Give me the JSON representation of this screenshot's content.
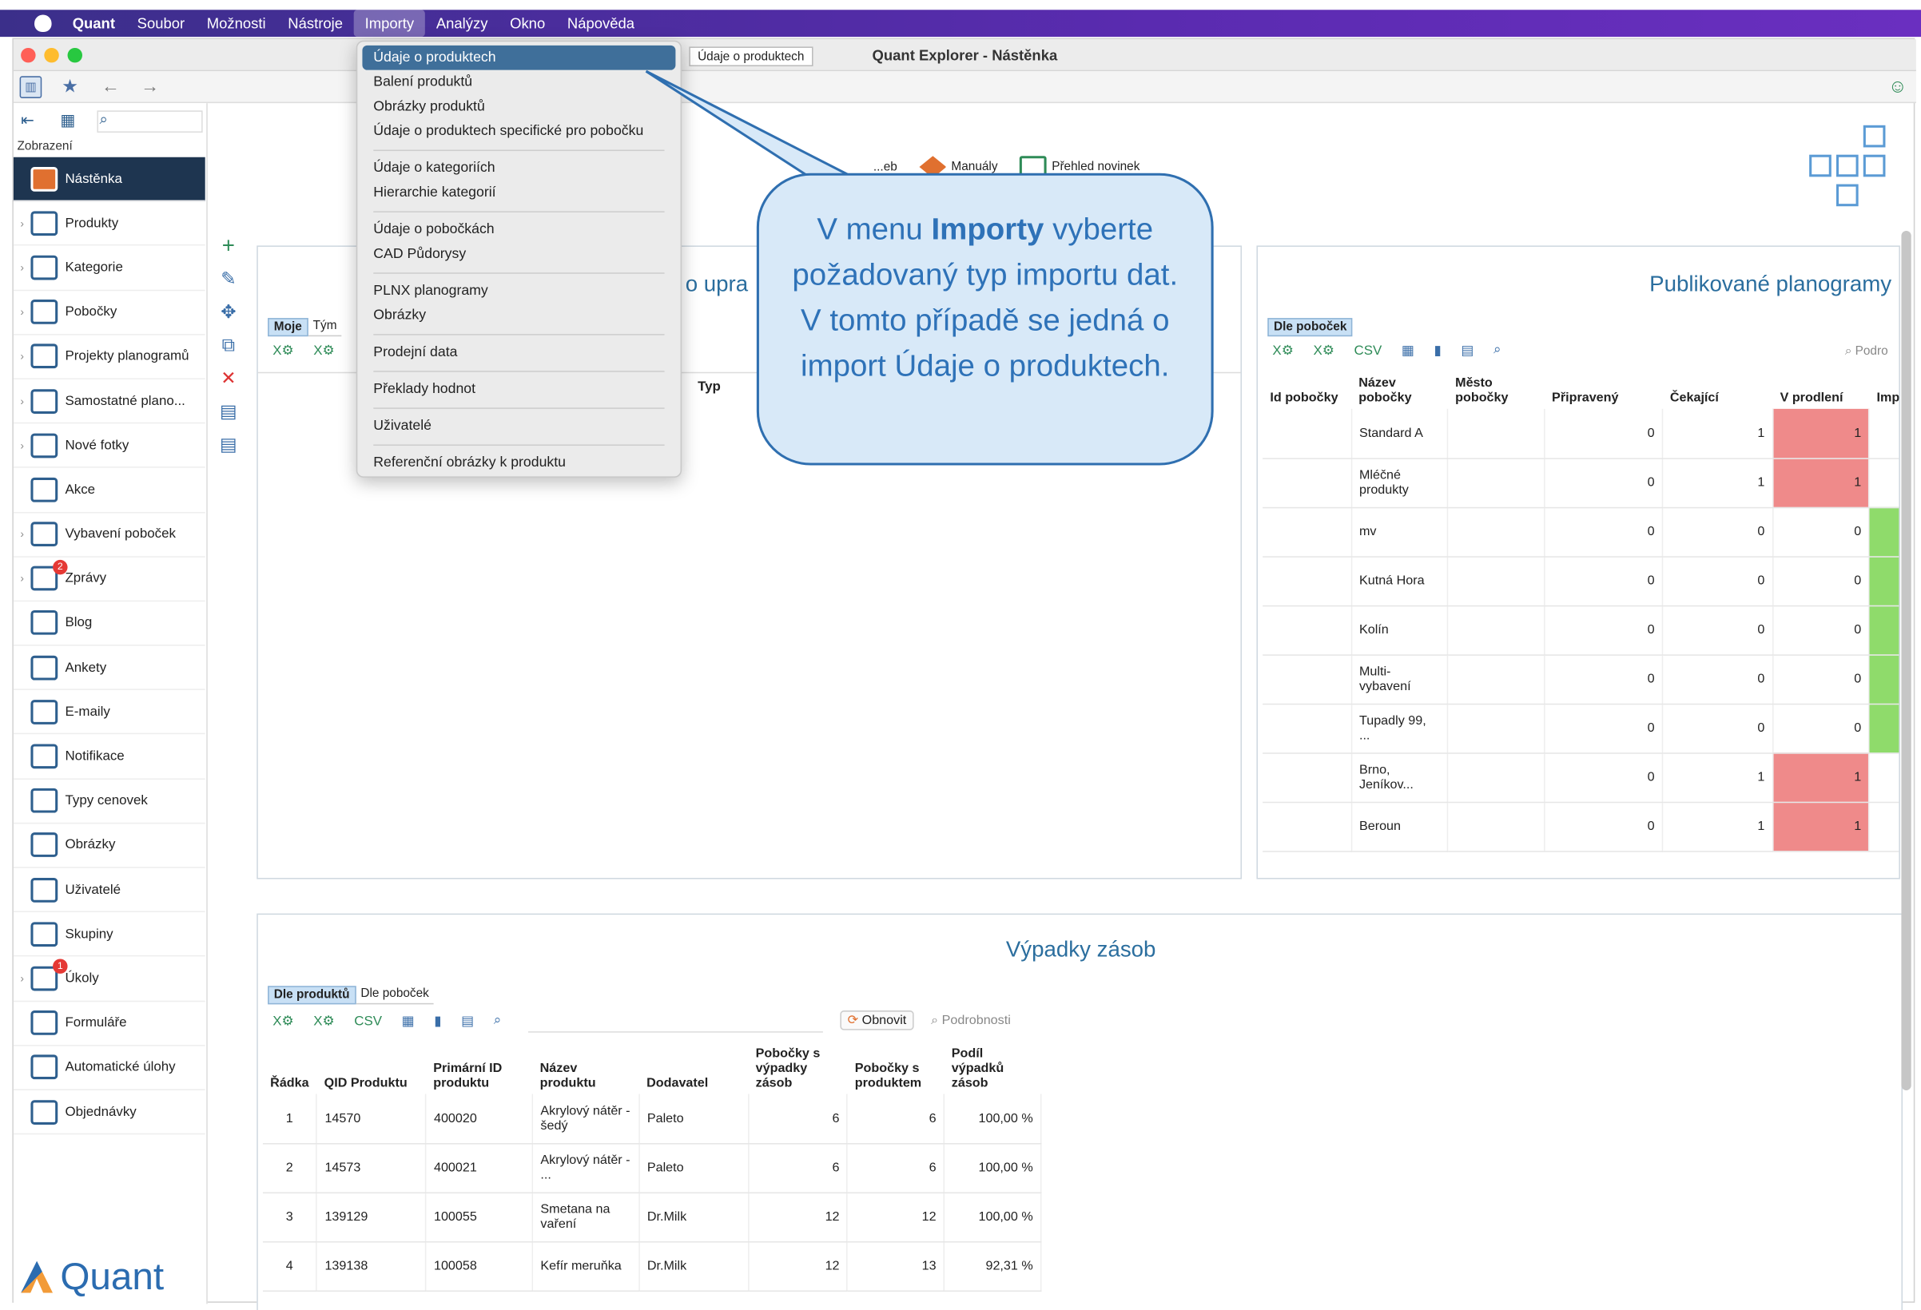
{
  "menubar": {
    "app": "Quant",
    "items": [
      "Soubor",
      "Možnosti",
      "Nástroje",
      "Importy",
      "Analýzy",
      "Okno",
      "Nápověda"
    ],
    "active": "Importy"
  },
  "window": {
    "title": "Quant Explorer - Nástěnka",
    "tooltip": "Údaje o produktech"
  },
  "sidebar": {
    "section_label": "Zobrazení",
    "items": [
      {
        "label": "Nástěnka",
        "active": true,
        "chevron": false,
        "badge": ""
      },
      {
        "label": "Produkty",
        "chevron": true,
        "badge": ""
      },
      {
        "label": "Kategorie",
        "chevron": true,
        "badge": ""
      },
      {
        "label": "Pobočky",
        "chevron": true,
        "badge": ""
      },
      {
        "label": "Projekty planogramů",
        "chevron": true,
        "badge": ""
      },
      {
        "label": "Samostatné plano...",
        "chevron": true,
        "badge": ""
      },
      {
        "label": "Nové fotky",
        "chevron": true,
        "badge": ""
      },
      {
        "label": "Akce",
        "chevron": false,
        "badge": ""
      },
      {
        "label": "Vybavení poboček",
        "chevron": true,
        "badge": ""
      },
      {
        "label": "Zprávy",
        "chevron": true,
        "badge": "2"
      },
      {
        "label": "Blog",
        "chevron": false,
        "badge": ""
      },
      {
        "label": "Ankety",
        "chevron": false,
        "badge": ""
      },
      {
        "label": "E-maily",
        "chevron": false,
        "badge": ""
      },
      {
        "label": "Notifikace",
        "chevron": false,
        "badge": ""
      },
      {
        "label": "Typy cenovek",
        "chevron": false,
        "badge": ""
      },
      {
        "label": "Obrázky",
        "chevron": false,
        "badge": ""
      },
      {
        "label": "Uživatelé",
        "chevron": false,
        "badge": ""
      },
      {
        "label": "Skupiny",
        "chevron": false,
        "badge": ""
      },
      {
        "label": "Úkoly",
        "chevron": true,
        "badge": "1"
      },
      {
        "label": "Formuláře",
        "chevron": false,
        "badge": ""
      },
      {
        "label": "Automatické úlohy",
        "chevron": false,
        "badge": ""
      },
      {
        "label": "Objednávky",
        "chevron": false,
        "badge": ""
      }
    ],
    "logo_text": "Quant"
  },
  "header_links": {
    "partial": "...eb",
    "manuals": "Manuály",
    "news": "Přehled novinek"
  },
  "dropdown": {
    "groups": [
      [
        "Údaje o produktech",
        "Balení produktů",
        "Obrázky produktů",
        "Údaje o produktech specifické pro pobočku"
      ],
      [
        "Údaje o kategoriích",
        "Hierarchie kategorií"
      ],
      [
        "Údaje o pobočkách",
        "CAD Půdorysy"
      ],
      [
        "PLNX planogramy",
        "Obrázky"
      ],
      [
        "Prodejní data"
      ],
      [
        "Překlady hodnot"
      ],
      [
        "Uživatelé"
      ],
      [
        "Referenční obrázky k produktu"
      ]
    ],
    "selected": "Údaje o produktech"
  },
  "callout": {
    "pre": "V menu ",
    "bold": "Importy",
    "post": " vyberte požadovaný typ importu dat. V tomto případě se jedná o import Údaje o produktech."
  },
  "panel_left": {
    "title_fragment": "o upra",
    "tabs": [
      "Moje",
      "Tým"
    ],
    "col_type": "Typ"
  },
  "panel_planograms": {
    "title": "Publikované planogramy",
    "tab": "Dle poboček",
    "detail_label": "Podro",
    "columns": [
      "Id pobočky",
      "Název pobočky",
      "Město pobočky",
      "Připravený",
      "Čekající",
      "V prodlení",
      "Impleme"
    ],
    "rows": [
      {
        "name": "Standard A",
        "ready": "0",
        "wait": "1",
        "late": "1",
        "late_red": true,
        "impl_green": false
      },
      {
        "name": "Mléčné produkty",
        "ready": "0",
        "wait": "1",
        "late": "1",
        "late_red": true,
        "impl_green": false
      },
      {
        "name": "mv",
        "ready": "0",
        "wait": "0",
        "late": "0",
        "late_red": false,
        "impl_green": true
      },
      {
        "name": "Kutná Hora",
        "ready": "0",
        "wait": "0",
        "late": "0",
        "late_red": false,
        "impl_green": true
      },
      {
        "name": "Kolín",
        "ready": "0",
        "wait": "0",
        "late": "0",
        "late_red": false,
        "impl_green": true
      },
      {
        "name": "Multi-vybavení",
        "ready": "0",
        "wait": "0",
        "late": "0",
        "late_red": false,
        "impl_green": true
      },
      {
        "name": "Tupadly 99, ...",
        "ready": "0",
        "wait": "0",
        "late": "0",
        "late_red": false,
        "impl_green": true
      },
      {
        "name": "Brno, Jeníkov...",
        "ready": "0",
        "wait": "1",
        "late": "1",
        "late_red": true,
        "impl_green": false
      },
      {
        "name": "Beroun",
        "ready": "0",
        "wait": "1",
        "late": "1",
        "late_red": true,
        "impl_green": false
      }
    ]
  },
  "panel_outages": {
    "title": "Výpadky zásob",
    "tabs": [
      "Dle produktů",
      "Dle poboček"
    ],
    "refresh": "Obnovit",
    "details": "Podrobnosti",
    "columns": [
      "Řádka",
      "QID Produktu",
      "Primární ID produktu",
      "Název produktu",
      "Dodavatel",
      "Pobočky s výpadky zásob",
      "Pobočky s produktem",
      "Podíl výpadků zásob"
    ],
    "rows": [
      [
        "1",
        "14570",
        "400020",
        "Akrylový nátěr - šedý",
        "Paleto",
        "6",
        "6",
        "100,00 %"
      ],
      [
        "2",
        "14573",
        "400021",
        "Akrylový nátěr - ...",
        "Paleto",
        "6",
        "6",
        "100,00 %"
      ],
      [
        "3",
        "139129",
        "100055",
        "Smetana na vaření",
        "Dr.Milk",
        "12",
        "12",
        "100,00 %"
      ],
      [
        "4",
        "139138",
        "100058",
        "Kefír meruňka",
        "Dr.Milk",
        "12",
        "13",
        "92,31 %"
      ]
    ]
  }
}
